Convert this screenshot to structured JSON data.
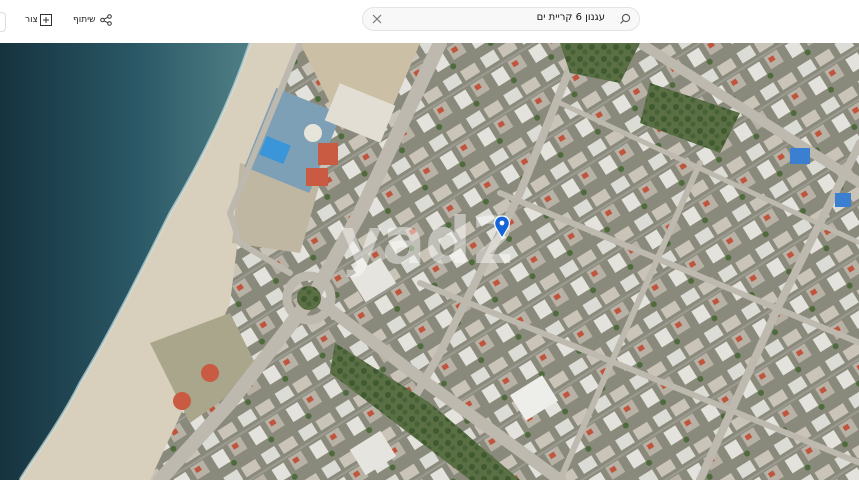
{
  "search": {
    "query": "עגנון 6 קריית ים"
  },
  "toolbar": {
    "share_label": "שיתוף",
    "draw_label": "צור"
  },
  "map": {
    "watermark": "yad2"
  },
  "colors": {
    "accent": "#1565d8",
    "sea": "#2d5e6b",
    "sand": "#d9d2bf"
  }
}
